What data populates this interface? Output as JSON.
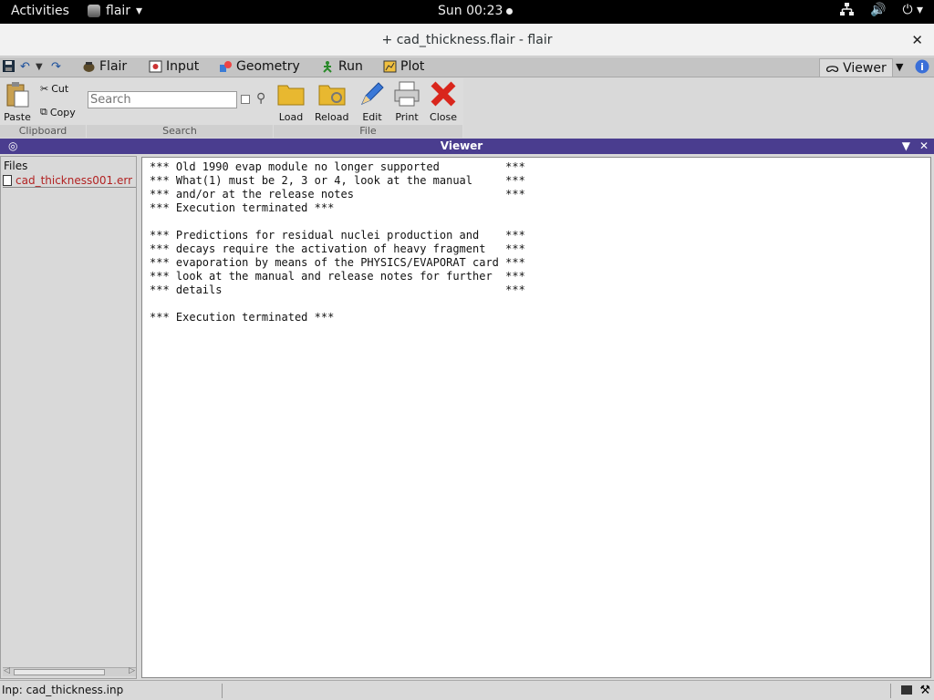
{
  "topbar": {
    "activities": "Activities",
    "app_name": "flair",
    "clock": "Sun 00:23"
  },
  "window": {
    "title": "+ cad_thickness.flair - flair"
  },
  "ribbon_tabs": [
    {
      "label": "Flair"
    },
    {
      "label": "Input"
    },
    {
      "label": "Geometry"
    },
    {
      "label": "Run"
    },
    {
      "label": "Plot"
    }
  ],
  "viewer_tab": "Viewer",
  "ribbon": {
    "clipboard": {
      "paste": "Paste",
      "cut": "Cut",
      "copy": "Copy",
      "label": "Clipboard"
    },
    "search": {
      "placeholder": "Search",
      "label": "Search"
    },
    "file": {
      "load": "Load",
      "reload": "Reload",
      "edit": "Edit",
      "print": "Print",
      "close": "Close",
      "label": "File"
    }
  },
  "viewer_header": "Viewer",
  "files": {
    "label": "Files",
    "items": [
      "cad_thickness001.err"
    ]
  },
  "content": "*** Old 1990 evap module no longer supported          ***\n*** What(1) must be 2, 3 or 4, look at the manual     ***\n*** and/or at the release notes                       ***\n*** Execution terminated ***\n\n*** Predictions for residual nuclei production and    ***\n*** decays require the activation of heavy fragment   ***\n*** evaporation by means of the PHYSICS/EVAPORAT card ***\n*** look at the manual and release notes for further  ***\n*** details                                           ***\n\n*** Execution terminated ***",
  "status": {
    "input_file": "Inp: cad_thickness.inp"
  },
  "colors": {
    "viewer_header": "#4a3d8f",
    "file_item": "#b22222",
    "close_icon": "#d9261c"
  }
}
